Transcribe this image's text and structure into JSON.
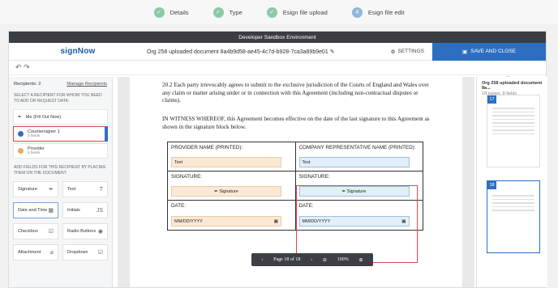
{
  "steps": [
    {
      "label": "Details",
      "state": "done"
    },
    {
      "label": "Type",
      "state": "done"
    },
    {
      "label": "Esign file upload",
      "state": "done"
    },
    {
      "label": "Esign file edit",
      "state": "current",
      "num": "4"
    }
  ],
  "devbar": "Developer Sandbox Environment",
  "header": {
    "logo": "signNow",
    "title": "Org 258 uploaded document 8a4b9d58-ae45-4c7d-b928-7ca3a89b9e01",
    "settings": "SETTINGS",
    "save": "SAVE AND CLOSE"
  },
  "left": {
    "recipients_label": "Recipients: 2",
    "manage": "Manage Recipients",
    "select_text": "SELECT A RECIPIENT FOR WHOM YOU NEED TO ADD OR REQUEST DATA:",
    "recipients": [
      {
        "name": "Me (Fill Out Now)",
        "sub": "",
        "color": "#888"
      },
      {
        "name": "Countersigner 1",
        "sub": "3 fields",
        "color": "#2c6fc1"
      },
      {
        "name": "Provider",
        "sub": "5 fields",
        "color": "#f0a85a"
      }
    ],
    "add_text": "ADD FIELDS FOR THIS RECIPIENT BY PLACING THEM ON THE DOCUMENT:",
    "fields": [
      {
        "label": "Signature",
        "icon": "✒"
      },
      {
        "label": "Text",
        "icon": "T"
      },
      {
        "label": "Date and Time",
        "icon": "▦"
      },
      {
        "label": "Initials",
        "icon": "JS"
      },
      {
        "label": "Checkbox",
        "icon": "☑"
      },
      {
        "label": "Radio Buttons",
        "icon": "◉"
      },
      {
        "label": "Attachment",
        "icon": "⌀"
      },
      {
        "label": "Dropdown",
        "icon": "☑"
      }
    ]
  },
  "doc": {
    "para1": "20.2   Each party irrevocably agrees to submit to the exclusive jurisdiction of the Courts of England and Wales over any claim or matter arising under or in connection with this Agreement (including non-contractual disputes or claims).",
    "para2": "IN WITNESS WHEREOF, this Agreement becomes effective on the date of the last signature to this Agreement as shown in the signature block below.",
    "provider_name": "PROVIDER NAME (PRINTED):",
    "company_name": "COMPANY REPRESENTATIVE NAME (PRINTED):",
    "text": "Text",
    "signature_label": "SIGNATURE:",
    "signature_btn": "Signature",
    "date_label": "DATE:",
    "date_ph": "MM/DD/YYYY"
  },
  "pager": {
    "page": "Page 18 of 18",
    "zoom": "100%"
  },
  "right": {
    "title": "Org 258 uploaded document 8a...",
    "meta": "18 pages, 8 fields",
    "thumbs": [
      "17",
      "18"
    ]
  }
}
